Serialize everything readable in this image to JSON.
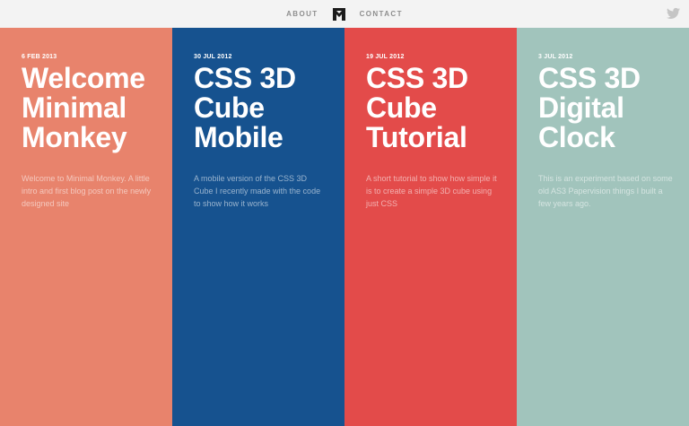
{
  "header": {
    "nav_about": "ABOUT",
    "nav_contact": "CONTACT",
    "logo_icon": "minimal-monkey-logo-icon",
    "social_icon": "twitter-icon"
  },
  "panels": [
    {
      "date": "6 FEB 2013",
      "title_lines": [
        "Welcome",
        "Minimal",
        "Monkey"
      ],
      "description": "Welcome to Minimal Monkey. A little intro and first blog post on the newly designed site",
      "color": "#e8836c"
    },
    {
      "date": "30 JUL 2012",
      "title_lines": [
        "CSS 3D",
        "Cube",
        "Mobile"
      ],
      "description": "A mobile version of the CSS 3D Cube I recently made with the code to show how it works",
      "color": "#16528f"
    },
    {
      "date": "19 JUL 2012",
      "title_lines": [
        "CSS 3D",
        "Cube",
        "Tutorial"
      ],
      "description": "A short tutorial to show how simple it is to create a simple 3D cube using just CSS",
      "color": "#e34b4a"
    },
    {
      "date": "3 JUL 2012",
      "title_lines": [
        "CSS 3D",
        "Digital",
        "Clock"
      ],
      "description": "This is an experiment based on some old AS3 Papervision things I built a few years ago.",
      "color": "#a1c4bc"
    }
  ]
}
